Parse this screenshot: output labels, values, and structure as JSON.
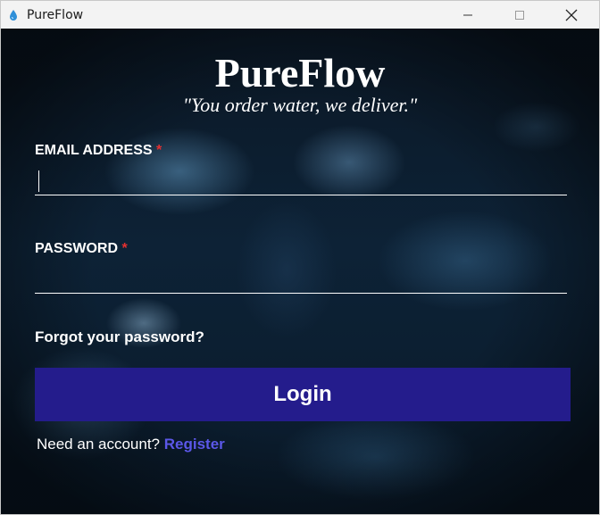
{
  "window": {
    "title": "PureFlow",
    "icon": "water-drop-icon"
  },
  "header": {
    "app_name": "PureFlow",
    "tagline": "\"You order water, we deliver.\""
  },
  "form": {
    "email": {
      "label": "EMAIL ADDRESS",
      "required_mark": "*",
      "value": "",
      "placeholder": ""
    },
    "password": {
      "label": "PASSWORD",
      "required_mark": "*",
      "value": "",
      "placeholder": ""
    },
    "forgot_link": "Forgot your password?",
    "login_label": "Login",
    "register_prompt": "Need an account?",
    "register_link": "Register"
  },
  "colors": {
    "login_button": "#241c8c",
    "register_link": "#5b57e8",
    "required_mark": "#e53030"
  }
}
